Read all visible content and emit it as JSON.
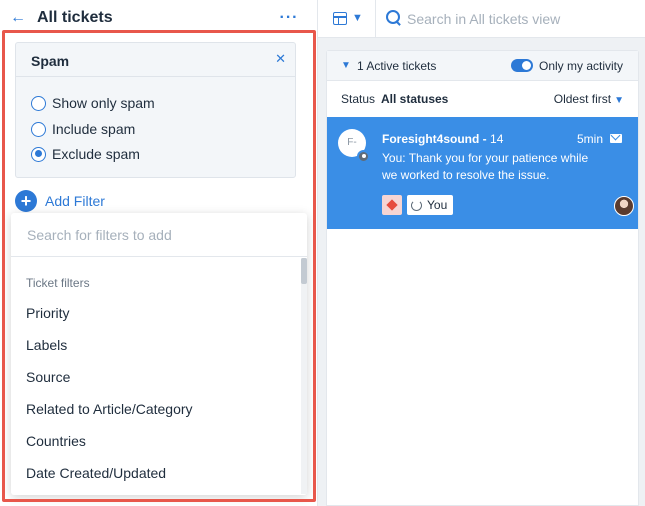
{
  "left_panel": {
    "title": "All tickets",
    "back_icon": "arrow-left-icon",
    "more_icon": "ellipsis-icon",
    "spam_filter": {
      "title": "Spam",
      "close_icon": "close-icon",
      "options": [
        {
          "label": "Show only spam",
          "checked": false
        },
        {
          "label": "Include spam",
          "checked": false
        },
        {
          "label": "Exclude spam",
          "checked": true
        }
      ]
    },
    "add_filter": {
      "label": "Add Filter",
      "icon": "plus-circle-icon"
    },
    "dropdown": {
      "search_placeholder": "Search for filters to add",
      "section_label": "Ticket filters",
      "items": [
        "Priority",
        "Labels",
        "Source",
        "Related to Article/Category",
        "Countries",
        "Date Created/Updated"
      ]
    }
  },
  "right_panel": {
    "view_icon": "layout-icon",
    "view_chevron_icon": "chevron-down-icon",
    "search_icon": "search-icon",
    "search_placeholder": "Search in All tickets view",
    "list": {
      "chevron_icon": "chevron-down-icon",
      "header_label": "1 Active tickets",
      "toggle_label": "Only my activity",
      "toggle_on": true,
      "status_key": "Status",
      "status_value": "All statuses",
      "sort_label": "Oldest first"
    },
    "ticket": {
      "avatar_text": "F-",
      "from": "Foresight4sound -",
      "id": "14",
      "time": "5min",
      "channel_icon": "mail-icon",
      "preview": "You: Thank you for your patience while we worked to resolve the issue.",
      "priority_icon": "priority-diamond-icon",
      "assignee_icon": "sync-icon",
      "assignee": "You"
    }
  },
  "colors": {
    "accent": "#2d79d6",
    "selected_ticket": "#3a8ee6",
    "highlight_frame": "#e8574b",
    "priority": "#e64b3c"
  }
}
